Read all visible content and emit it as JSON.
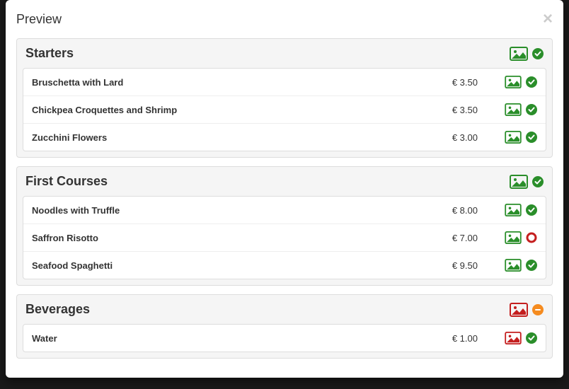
{
  "modal": {
    "title": "Preview"
  },
  "colors": {
    "green": "#2a8e2a",
    "red": "#c41e1e",
    "orange": "#f58b1f"
  },
  "statusIcons": {
    "check": "check",
    "ring": "ring",
    "minus": "minus"
  },
  "categories": [
    {
      "name": "Starters",
      "imageColor": "green",
      "status": "check",
      "items": [
        {
          "name": "Bruschetta with Lard",
          "price": "€ 3.50",
          "imageColor": "green",
          "status": "check"
        },
        {
          "name": "Chickpea Croquettes and Shrimp",
          "price": "€ 3.50",
          "imageColor": "green",
          "status": "check"
        },
        {
          "name": "Zucchini Flowers",
          "price": "€ 3.00",
          "imageColor": "green",
          "status": "check"
        }
      ]
    },
    {
      "name": "First Courses",
      "imageColor": "green",
      "status": "check",
      "items": [
        {
          "name": "Noodles with Truffle",
          "price": "€ 8.00",
          "imageColor": "green",
          "status": "check"
        },
        {
          "name": "Saffron Risotto",
          "price": "€ 7.00",
          "imageColor": "green",
          "status": "ring"
        },
        {
          "name": "Seafood Spaghetti",
          "price": "€ 9.50",
          "imageColor": "green",
          "status": "check"
        }
      ]
    },
    {
      "name": "Beverages",
      "imageColor": "red",
      "status": "minus",
      "items": [
        {
          "name": "Water",
          "price": "€ 1.00",
          "imageColor": "red",
          "status": "check"
        }
      ]
    }
  ]
}
